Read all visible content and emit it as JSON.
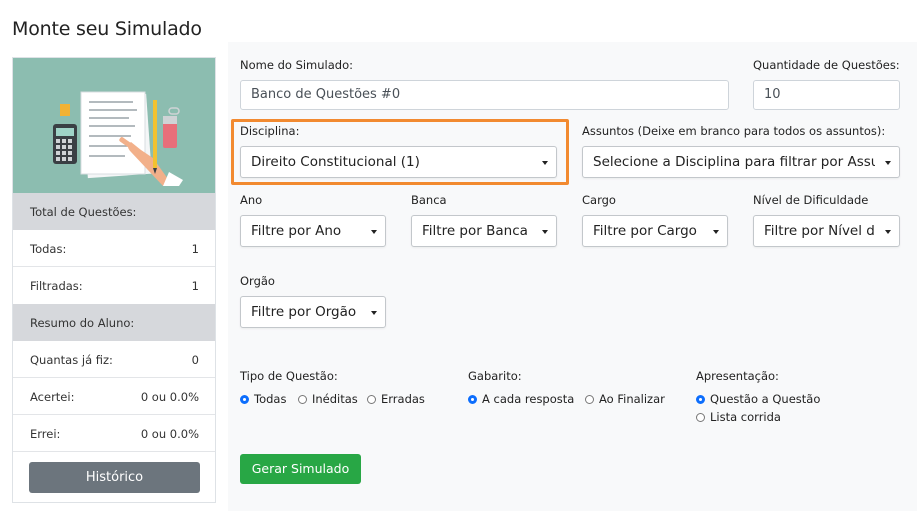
{
  "page": {
    "title": "Monte seu Simulado"
  },
  "sidebar": {
    "total_header": "Total de Questões:",
    "total_rows": [
      {
        "label": "Todas:",
        "value": "1"
      },
      {
        "label": "Filtradas:",
        "value": "1"
      }
    ],
    "resumo_header": "Resumo do Aluno:",
    "resumo_rows": [
      {
        "label": "Quantas já fiz:",
        "value": "0"
      },
      {
        "label": "Acertei:",
        "value": "0 ou 0.0%"
      },
      {
        "label": "Errei:",
        "value": "0 ou 0.0%"
      }
    ],
    "historico_label": "Histórico"
  },
  "form": {
    "nome": {
      "label": "Nome do Simulado:",
      "value": "Banco de Questões #0"
    },
    "quantidade": {
      "label": "Quantidade de Questões:",
      "value": "10"
    },
    "disciplina": {
      "label": "Disciplina:",
      "value": "Direito Constitucional (1)"
    },
    "assuntos": {
      "label": "Assuntos (Deixe em branco para todos os assuntos):",
      "value": "Selecione a Disciplina para filtrar por Assuntos"
    },
    "ano": {
      "label": "Ano",
      "value": "Filtre por Ano"
    },
    "banca": {
      "label": "Banca",
      "value": "Filtre por Banca"
    },
    "cargo": {
      "label": "Cargo",
      "value": "Filtre por Cargo"
    },
    "nivel": {
      "label": "Nível de Dificuldade",
      "value": "Filtre por Nível de Dificuldade"
    },
    "orgao": {
      "label": "Orgão",
      "value": "Filtre por Orgão"
    },
    "tipo": {
      "label": "Tipo de Questão:",
      "options": [
        "Todas",
        "Inéditas",
        "Erradas"
      ],
      "selected": "Todas"
    },
    "gabarito": {
      "label": "Gabarito:",
      "options": [
        "A cada resposta",
        "Ao Finalizar"
      ],
      "selected": "A cada resposta"
    },
    "apresentacao": {
      "label": "Apresentação:",
      "options": [
        "Questão a Questão",
        "Lista corrida"
      ],
      "selected": "Questão a Questão"
    },
    "gerar_label": "Gerar Simulado"
  },
  "colors": {
    "highlight": "#f28a30",
    "primary": "#0d6efd",
    "success": "#28a745",
    "secondary": "#6c757d"
  }
}
